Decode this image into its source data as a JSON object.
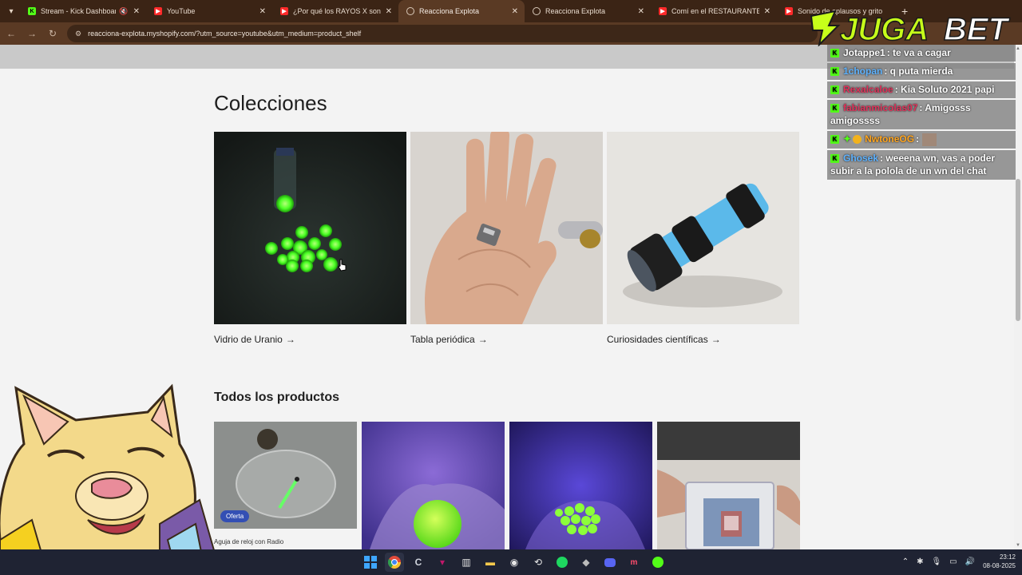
{
  "browser": {
    "tabs": [
      {
        "title": "Stream - Kick Dashboard",
        "favicon": "kick-icon",
        "muted": true,
        "active": false
      },
      {
        "title": "YouTube",
        "favicon": "youtube-icon",
        "active": false
      },
      {
        "title": "¿Por qué los RAYOS X son más",
        "favicon": "youtube-icon",
        "active": false
      },
      {
        "title": "Reacciona Explota",
        "favicon": "globe-icon",
        "active": true
      },
      {
        "title": "Reacciona Explota",
        "favicon": "globe-icon",
        "active": false
      },
      {
        "title": "Comí en el RESTAURANTE MÁS",
        "favicon": "youtube-icon",
        "active": false
      },
      {
        "title": "Sonido de aplausos y grito",
        "favicon": "youtube-icon",
        "active": false
      }
    ],
    "url": "reacciona-explota.myshopify.com/?utm_source=youtube&utm_medium=product_shelf",
    "colors": {
      "tab_strip": "#3b2415",
      "toolbar": "#5a3a24"
    }
  },
  "page": {
    "collections_title": "Colecciones",
    "collections": [
      {
        "label": "Vidrio de Uranio",
        "arrow": "→"
      },
      {
        "label": "Tabla periódica",
        "arrow": "→"
      },
      {
        "label": "Curiosidades científicas",
        "arrow": "→"
      }
    ],
    "products_title": "Todos los productos",
    "products": [
      {
        "label": "Aguja de reloj con Radio",
        "badge": "Oferta"
      },
      {
        "label": ""
      },
      {
        "label": ""
      },
      {
        "label": ""
      }
    ],
    "badge_color": "#334fb4"
  },
  "overlay": {
    "brand": {
      "part1": "JUGA",
      "part2": "BET"
    },
    "chat": [
      {
        "user": "Jotappe1",
        "text": ": te va a cagar",
        "color": "#ffffff"
      },
      {
        "user": "1chopan",
        "text": ": q puta mierda",
        "color": "#5fb3ff"
      },
      {
        "user": "Rexalcaloe",
        "text": ": Kia Soluto 2021 papi",
        "color": "#e0325a"
      },
      {
        "user": "fabianmicolas07",
        "text": ": Amigosss amigossss",
        "color": "#e0325a"
      },
      {
        "user": "NwtoneOG",
        "text": ":",
        "color": "#ffa51f"
      },
      {
        "user": "Ghosek",
        "text": ": weeena wn, vas a poder subir a la polola de un wn del chat",
        "color": "#5fb3ff"
      }
    ]
  },
  "taskbar": {
    "time": "23:12",
    "date": "08-08-2025",
    "apps": [
      "start-icon",
      "chrome-icon",
      "ccleaner-icon",
      "tradingview-icon",
      "streamer-icon",
      "files-icon",
      "obs-icon",
      "steam-icon",
      "spotify-icon",
      "epic-icon",
      "discord-icon",
      "meta-icon",
      "kick-icon"
    ]
  }
}
